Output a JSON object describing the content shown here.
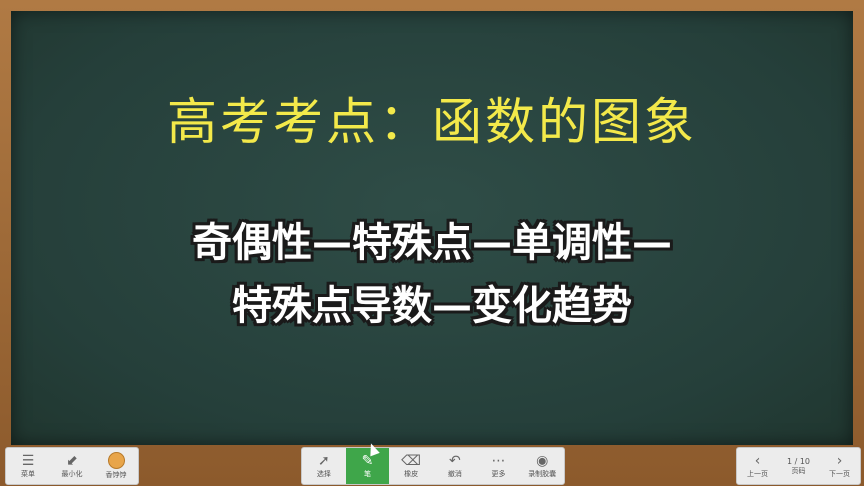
{
  "board": {
    "title": "高考考点：函数的图象",
    "line1": "奇偶性—特殊点—单调性—",
    "line2": "特殊点导数—变化趋势"
  },
  "toolbar_left": [
    {
      "label": "菜单",
      "icon": "menu-icon"
    },
    {
      "label": "最小化",
      "icon": "minimize-icon"
    },
    {
      "label": "香饽饽",
      "icon": "avatar-icon"
    }
  ],
  "toolbar_mid": [
    {
      "label": "选择",
      "icon": "cursor-icon"
    },
    {
      "label": "笔",
      "icon": "pen-icon"
    },
    {
      "label": "橡皮",
      "icon": "eraser-icon"
    },
    {
      "label": "撤消",
      "icon": "undo-icon"
    },
    {
      "label": "更多",
      "icon": "more-icon"
    },
    {
      "label": "录制胶囊",
      "icon": "record-icon"
    }
  ],
  "pager": {
    "prev_label": "上一页",
    "page_text": "1 / 10",
    "page_label": "页码",
    "next_label": "下一页"
  }
}
